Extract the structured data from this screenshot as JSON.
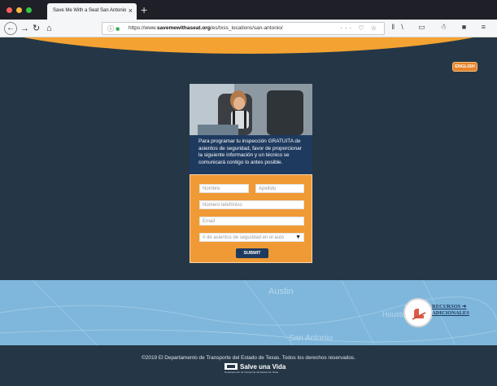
{
  "browser": {
    "tab_title": "Save Me With a Seat San Antonio",
    "new_tab": "+",
    "url_prefix": "https://www.",
    "url_domain": "savemewithaseat.org",
    "url_path": "/es/txss_locations/san-antonio/",
    "url_actions": "··· ♡ ☆",
    "toolbar_icons": "ǁ\\ ▭ ☃ ■ ≡",
    "colors": {
      "tab_bar": "#1f1f27",
      "toolbar": "#f5f6f7"
    }
  },
  "header": {
    "language_button": "ENGLISH",
    "colors": {
      "orange": "#f4a332",
      "navy": "#1e3a5f",
      "background": "#253746"
    }
  },
  "form": {
    "intro_text": "Para programar tu inspección GRATUITA de asientos de seguridad, favor de proporcionar la siguiente información y un técnico se comunicará contigo lo antes posible.",
    "first_name_placeholder": "Nombre",
    "last_name_placeholder": "Apellido",
    "phone_placeholder": "Número telefónico",
    "email_placeholder": "Email",
    "seats_select": "# de asientos de seguridad en el auto",
    "submit_label": "SUBMIT"
  },
  "map": {
    "labels": [
      "Austin",
      "Houston",
      "San Antonio"
    ]
  },
  "resources": {
    "line1": "RECURSOS",
    "line2": "ADICIONALES",
    "arrow": "➜"
  },
  "footer": {
    "copyright": "©2019 El Departamento de Transporte del Estado de Texas. Todos los derechos reservados.",
    "logo_text": "Salve una Vida",
    "logo_sub": "Departamento de Transporte del Estado de Texas"
  }
}
